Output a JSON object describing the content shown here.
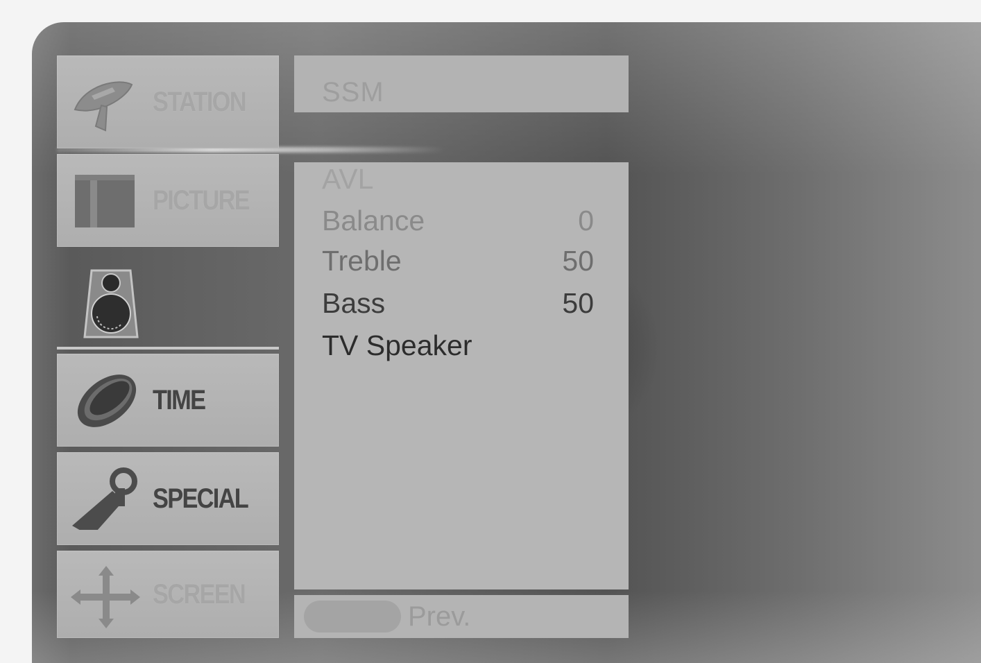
{
  "menu": {
    "categories": [
      {
        "id": "station",
        "label": "STATION",
        "icon": "satellite-dish-icon"
      },
      {
        "id": "picture",
        "label": "PICTURE",
        "icon": "picture-icon"
      },
      {
        "id": "sound",
        "label": "",
        "icon": "speaker-icon"
      },
      {
        "id": "time",
        "label": "TIME",
        "icon": "clock-icon"
      },
      {
        "id": "special",
        "label": "SPECIAL",
        "icon": "special-icon"
      },
      {
        "id": "screen",
        "label": "SCREEN",
        "icon": "move-arrows-icon"
      }
    ],
    "selected": "sound"
  },
  "submenu": {
    "header": "SSM",
    "items": [
      {
        "name": "AVL",
        "value": ""
      },
      {
        "name": "Balance",
        "value": "0"
      },
      {
        "name": "Treble",
        "value": "50"
      },
      {
        "name": "Bass",
        "value": "50"
      },
      {
        "name": "TV Speaker",
        "value": ""
      }
    ]
  },
  "footer": {
    "prev_label": "Prev."
  }
}
